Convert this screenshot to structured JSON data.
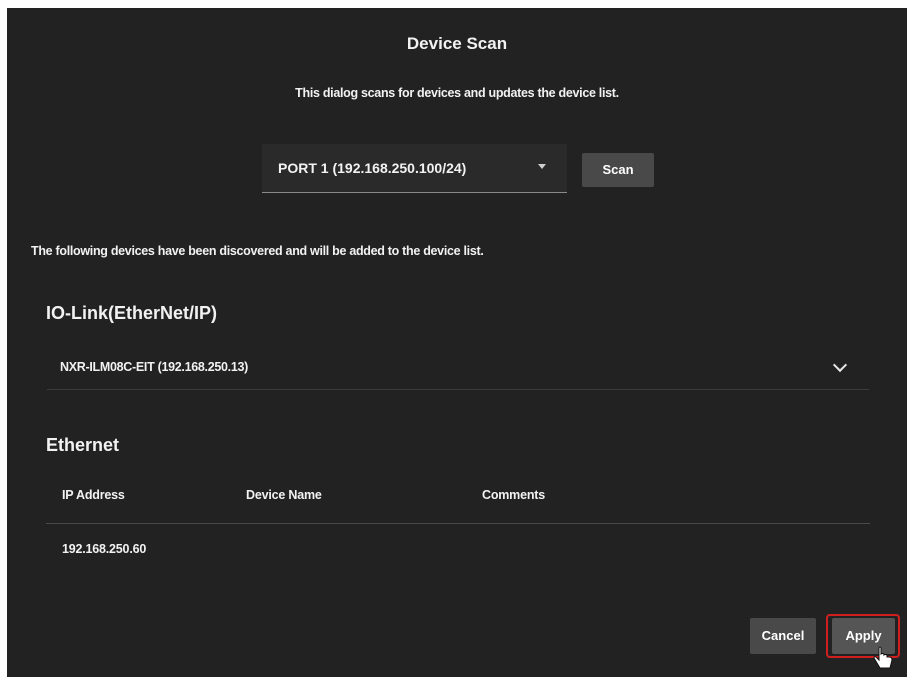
{
  "dialog": {
    "title": "Device Scan",
    "subtitle": "This dialog scans for devices and updates the device list."
  },
  "port": {
    "selected": "PORT 1 (192.168.250.100/24)"
  },
  "scan_button": "Scan",
  "discovered_text": "The following devices have been discovered and will be added to the device list.",
  "iolink": {
    "heading": "IO-Link(EtherNet/IP)",
    "devices": [
      "NXR-ILM08C-EIT (192.168.250.13)"
    ]
  },
  "ethernet": {
    "heading": "Ethernet",
    "columns": [
      "IP Address",
      "Device Name",
      "Comments"
    ],
    "rows": [
      {
        "ip": "192.168.250.60",
        "name": "",
        "comments": ""
      }
    ]
  },
  "buttons": {
    "cancel": "Cancel",
    "apply": "Apply"
  },
  "colors": {
    "background": "#222222",
    "button": "#494949",
    "highlight": "#d11f1f"
  }
}
